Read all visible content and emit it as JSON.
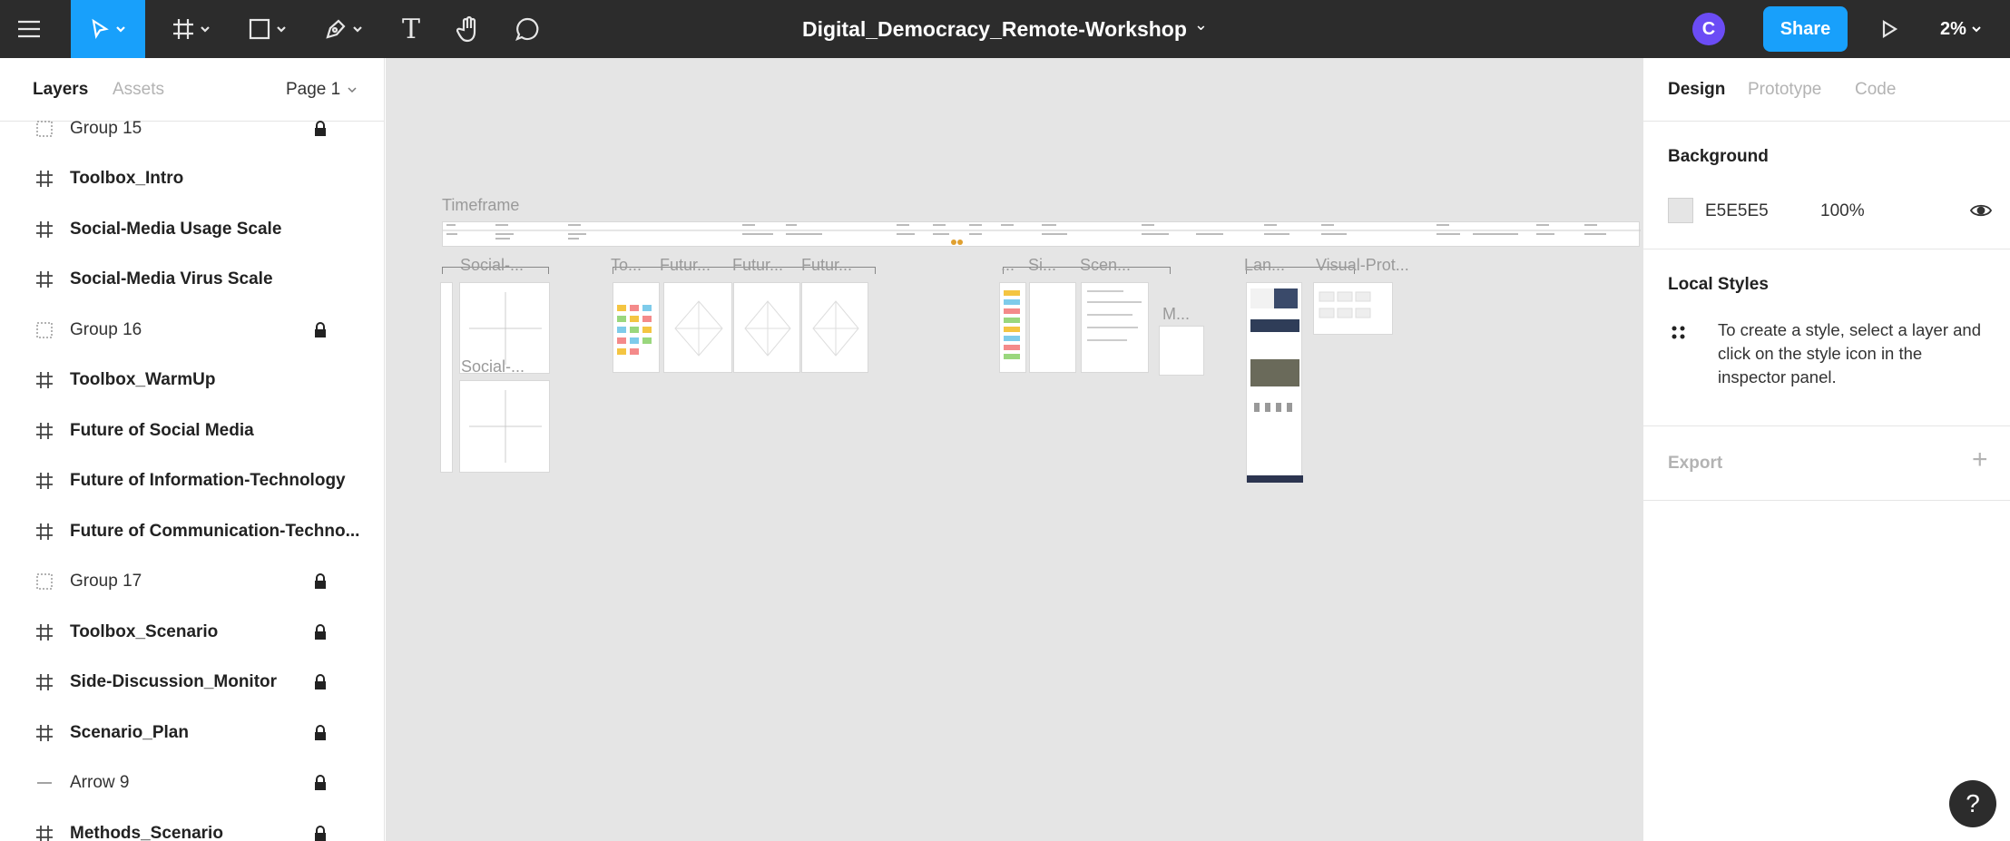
{
  "toolbar": {
    "file_title": "Digital_Democracy_Remote-Workshop",
    "avatar_initial": "C",
    "share_label": "Share",
    "zoom_level": "2%",
    "text_tool_glyph": "T",
    "chevron_glyph": "⌄",
    "accent_color": "#18a0fb"
  },
  "left_panel": {
    "tabs": [
      {
        "label": "Layers",
        "active": true
      },
      {
        "label": "Assets",
        "active": false
      }
    ],
    "page_selector": "Page 1",
    "layers": [
      {
        "name": "Group 15",
        "type": "group",
        "locked": true
      },
      {
        "name": "Toolbox_Intro",
        "type": "frame",
        "locked": false
      },
      {
        "name": "Social-Media Usage Scale",
        "type": "frame",
        "locked": false
      },
      {
        "name": "Social-Media Virus Scale",
        "type": "frame",
        "locked": false
      },
      {
        "name": "Group 16",
        "type": "group",
        "locked": true
      },
      {
        "name": "Toolbox_WarmUp",
        "type": "frame",
        "locked": false
      },
      {
        "name": "Future of Social Media",
        "type": "frame",
        "locked": false
      },
      {
        "name": "Future of Information-Technology",
        "type": "frame",
        "locked": false
      },
      {
        "name": "Future of Communication-Techno...",
        "type": "frame",
        "locked": false
      },
      {
        "name": "Group 17",
        "type": "group",
        "locked": true
      },
      {
        "name": "Toolbox_Scenario",
        "type": "frame",
        "locked": true
      },
      {
        "name": "Side-Discussion_Monitor",
        "type": "frame",
        "locked": true
      },
      {
        "name": "Scenario_Plan",
        "type": "frame",
        "locked": true
      },
      {
        "name": "Arrow 9",
        "type": "line",
        "locked": true
      },
      {
        "name": "Methods_Scenario",
        "type": "frame",
        "locked": true
      }
    ]
  },
  "canvas": {
    "background": "#E5E5E5",
    "labels": {
      "timeframe": "Timeframe",
      "social1": "Social-...",
      "social2": "Social-...",
      "to": "To...",
      "futur1": "Futur...",
      "futur2": "Futur...",
      "futur3": "Futur...",
      "dots": "...",
      "si": "Si...",
      "scen": "Scen...",
      "m": "M...",
      "lan": "Lan...",
      "visual": "Visual-Prot..."
    }
  },
  "right_panel": {
    "tabs": [
      {
        "label": "Design",
        "active": true
      },
      {
        "label": "Prototype",
        "active": false
      },
      {
        "label": "Code",
        "active": false
      }
    ],
    "background": {
      "heading": "Background",
      "hex": "E5E5E5",
      "opacity": "100%"
    },
    "local_styles": {
      "heading": "Local Styles",
      "hint": "To create a style, select a layer and click on the style icon in the inspector panel."
    },
    "export": {
      "heading": "Export",
      "add_glyph": "+"
    }
  },
  "help": {
    "glyph": "?"
  }
}
